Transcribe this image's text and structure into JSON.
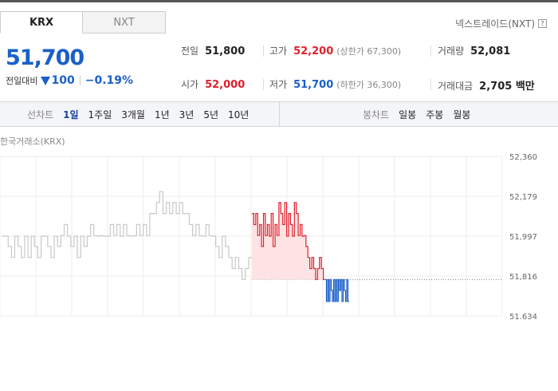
{
  "tabs": [
    {
      "label": "KRX",
      "active": true
    },
    {
      "label": "NXT",
      "active": false
    }
  ],
  "nxt_link": "넥스트레이드(NXT)",
  "help_icon": "?",
  "quote": {
    "price": "51,700",
    "change_label": "전일대비",
    "change_direction": "down",
    "change": "100",
    "change_pct": "−0.19%"
  },
  "stats": {
    "prev_label": "전일",
    "prev_value": "51,800",
    "high_label": "고가",
    "high_value": "52,200",
    "upper_limit": "(상한가 67,300)",
    "volume_label": "거래량",
    "volume_value": "52,081",
    "open_label": "시가",
    "open_value": "52,000",
    "low_label": "저가",
    "low_value": "51,700",
    "lower_limit": "(하한가 36,300)",
    "amount_label": "거래대금",
    "amount_value": "2,705 백만"
  },
  "toolbar": {
    "line_label": "선차트",
    "line_items": [
      "1일",
      "1주일",
      "3개월",
      "1년",
      "3년",
      "5년",
      "10년"
    ],
    "selected": "1일",
    "candle_label": "봉차트",
    "candle_items": [
      "일봉",
      "주봉",
      "월봉"
    ]
  },
  "exchange_label": "한국거래소(KRX)",
  "colors": {
    "up": "#e0202c",
    "down": "#1a60c8",
    "flat": "#c8c8c8",
    "accent": "#1a3f9e"
  },
  "chart_data": {
    "type": "line",
    "title": "",
    "y_ticks": [
      "52,360",
      "52,179",
      "51,997",
      "51,816",
      "51,634"
    ],
    "ylim": [
      51634,
      52360
    ],
    "reference_line": 51800,
    "grid": true,
    "series": [
      {
        "segment": "before",
        "color": "gray",
        "values": [
          51997,
          51997,
          51950,
          51900,
          51997,
          51950,
          51900,
          51997,
          51900,
          51997,
          51950,
          51900,
          51997,
          51997,
          51950,
          51900,
          51997,
          51950,
          52000,
          52050,
          51997,
          51950,
          51997,
          51900,
          51997,
          51950,
          51997,
          52050,
          52000,
          51997,
          52000,
          51997,
          51997,
          52050,
          52000,
          52050,
          51997,
          52050,
          52000,
          51997,
          52000,
          52050,
          52000,
          52050,
          52000,
          52100,
          52100,
          52150,
          52200,
          52100,
          52150,
          52100,
          52150,
          52100,
          52150,
          52100,
          52100,
          52050,
          52000,
          52050,
          52000,
          51997,
          52050,
          52000,
          51997,
          51950,
          51900,
          51997,
          51950,
          51900,
          51850,
          51900,
          51850,
          51800,
          51850,
          51900
        ]
      },
      {
        "segment": "active_up",
        "color": "red",
        "values": [
          52100,
          52050,
          52100,
          52000,
          52050,
          51950,
          52100,
          52000,
          52050,
          51997,
          52100,
          51950,
          52050,
          52000,
          52150,
          52100,
          52050,
          52150,
          51997,
          52100,
          52050,
          51997,
          52150,
          52100,
          52000,
          52050,
          51997,
          52000,
          51950,
          51900,
          51850,
          51900,
          51850,
          51800,
          51850,
          51900,
          51850,
          51800
        ]
      },
      {
        "segment": "active_down",
        "color": "blue",
        "values": [
          51800,
          51700,
          51800,
          51700,
          51800,
          51750,
          51700,
          51800,
          51700,
          51800,
          51700,
          51800,
          51750,
          51800,
          51700,
          51800,
          51750,
          51700,
          51800,
          51700
        ]
      }
    ]
  }
}
